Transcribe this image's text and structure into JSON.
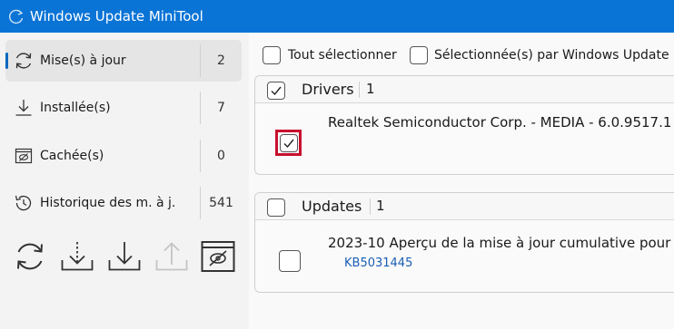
{
  "window": {
    "title": "Windows Update MiniTool"
  },
  "sidebar": {
    "items": [
      {
        "label": "Mise(s) à jour",
        "count": "2",
        "icon": "refresh-icon",
        "active": true
      },
      {
        "label": "Installée(s)",
        "count": "7",
        "icon": "download-icon",
        "active": false
      },
      {
        "label": "Cachée(s)",
        "count": "0",
        "icon": "hidden-icon",
        "active": false
      },
      {
        "label": "Historique des m. à j.",
        "count": "541",
        "icon": "history-icon",
        "active": false
      }
    ],
    "toolbar": [
      {
        "name": "check-updates",
        "icon": "refresh-icon",
        "enabled": true
      },
      {
        "name": "download",
        "icon": "download-dashed-icon",
        "enabled": true
      },
      {
        "name": "install",
        "icon": "install-icon",
        "enabled": true
      },
      {
        "name": "uninstall",
        "icon": "upload-icon",
        "enabled": false
      },
      {
        "name": "hide",
        "icon": "hide-window-icon",
        "enabled": true
      }
    ]
  },
  "main": {
    "select_all_label": "Tout sélectionner",
    "select_by_wu_label": "Sélectionnée(s) par Windows Update",
    "groups": [
      {
        "name": "Drivers",
        "count": "1",
        "checked": true,
        "items": [
          {
            "title": "Realtek Semiconductor Corp. - MEDIA - 6.0.9517.1",
            "kb": "",
            "checked": true,
            "highlighted": true
          }
        ]
      },
      {
        "name": "Updates",
        "count": "1",
        "checked": false,
        "items": [
          {
            "title": "2023-10 Aperçu de la mise à jour cumulative pour",
            "kb": "KB5031445",
            "checked": false,
            "highlighted": false
          }
        ]
      }
    ]
  },
  "colors": {
    "titlebar": "#0a74d6",
    "accent": "#0067c0",
    "highlight": "#c8102e",
    "link": "#1a5fb4"
  }
}
